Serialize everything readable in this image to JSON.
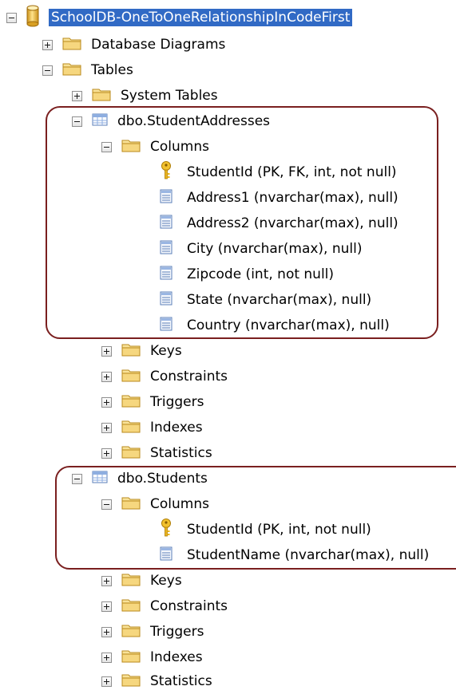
{
  "tree": {
    "root": {
      "label": "SchoolDB-OneToOneRelationshipInCodeFirst",
      "state": "expanded",
      "icon": "database-icon"
    },
    "nodes": [
      {
        "label": "Database Diagrams",
        "state": "collapsed",
        "icon": "folder-icon"
      },
      {
        "label": "Tables",
        "state": "expanded",
        "icon": "folder-icon"
      },
      {
        "label": "System Tables",
        "state": "collapsed",
        "icon": "folder-icon"
      },
      {
        "label": "dbo.StudentAddresses",
        "state": "expanded",
        "icon": "table-icon"
      },
      {
        "label": "Columns",
        "state": "expanded",
        "icon": "folder-icon"
      },
      {
        "label": "StudentId (PK, FK, int, not null)",
        "icon": "key-icon"
      },
      {
        "label": "Address1 (nvarchar(max), null)",
        "icon": "column-icon"
      },
      {
        "label": "Address2 (nvarchar(max), null)",
        "icon": "column-icon"
      },
      {
        "label": "City (nvarchar(max), null)",
        "icon": "column-icon"
      },
      {
        "label": "Zipcode (int, not null)",
        "icon": "column-icon"
      },
      {
        "label": "State (nvarchar(max), null)",
        "icon": "column-icon"
      },
      {
        "label": "Country (nvarchar(max), null)",
        "icon": "column-icon"
      },
      {
        "label": "Keys",
        "state": "collapsed",
        "icon": "folder-icon"
      },
      {
        "label": "Constraints",
        "state": "collapsed",
        "icon": "folder-icon"
      },
      {
        "label": "Triggers",
        "state": "collapsed",
        "icon": "folder-icon"
      },
      {
        "label": "Indexes",
        "state": "collapsed",
        "icon": "folder-icon"
      },
      {
        "label": "Statistics",
        "state": "collapsed",
        "icon": "folder-icon"
      },
      {
        "label": "dbo.Students",
        "state": "expanded",
        "icon": "table-icon"
      },
      {
        "label": "Columns",
        "state": "expanded",
        "icon": "folder-icon"
      },
      {
        "label": "StudentId (PK, int, not null)",
        "icon": "key-icon"
      },
      {
        "label": "StudentName (nvarchar(max), null)",
        "icon": "column-icon"
      },
      {
        "label": "Keys",
        "state": "collapsed",
        "icon": "folder-icon"
      },
      {
        "label": "Constraints",
        "state": "collapsed",
        "icon": "folder-icon"
      },
      {
        "label": "Triggers",
        "state": "collapsed",
        "icon": "folder-icon"
      },
      {
        "label": "Indexes",
        "state": "collapsed",
        "icon": "folder-icon"
      },
      {
        "label": "Statistics",
        "state": "collapsed",
        "icon": "folder-icon"
      }
    ]
  },
  "colors": {
    "selection": "#316ac5",
    "highlight_frame": "#7a1f1f",
    "folder": "#f3d27a"
  }
}
